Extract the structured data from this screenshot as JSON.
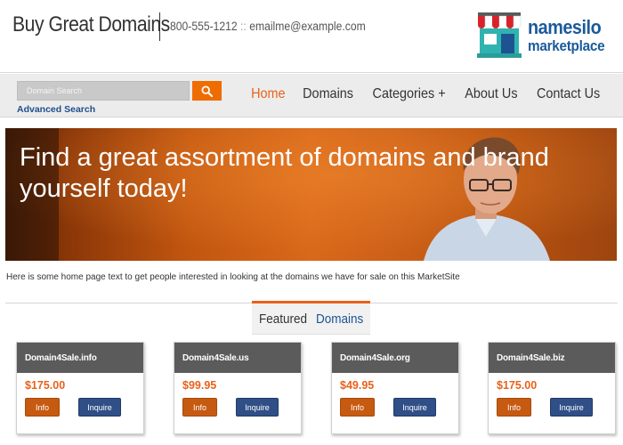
{
  "header": {
    "site_title": "Buy Great Domains",
    "phone": "800-555-1212",
    "separator": "::",
    "email": "emailme@example.com",
    "logo_line1": "namesilo",
    "logo_line2": "marketplace",
    "logo_icon": "storefront-icon"
  },
  "search": {
    "placeholder": "Domain Search",
    "button_icon": "search-icon",
    "advanced_label": "Advanced Search"
  },
  "nav": {
    "items": [
      {
        "label": "Home",
        "active": true
      },
      {
        "label": "Domains",
        "active": false
      },
      {
        "label": "Categories +",
        "active": false
      },
      {
        "label": "About Us",
        "active": false
      },
      {
        "label": "Contact Us",
        "active": false
      }
    ]
  },
  "hero": {
    "headline": "Find a great assortment of domains and brand yourself today!"
  },
  "intro_text": "Here is some home page text to get people interested in looking at the domains we have for sale on this MarketSite",
  "featured": {
    "label_part1": "Featured",
    "label_part2": "Domains",
    "cards": [
      {
        "domain": "Domain4Sale.info",
        "price": "$175.00",
        "info_label": "Info",
        "inquire_label": "Inquire"
      },
      {
        "domain": "Domain4Sale.us",
        "price": "$99.95",
        "info_label": "Info",
        "inquire_label": "Inquire"
      },
      {
        "domain": "Domain4Sale.org",
        "price": "$49.95",
        "info_label": "Info",
        "inquire_label": "Inquire"
      },
      {
        "domain": "Domain4Sale.biz",
        "price": "$175.00",
        "info_label": "Info",
        "inquire_label": "Inquire"
      }
    ]
  },
  "colors": {
    "accent_orange": "#e8611a",
    "brand_blue": "#1e5391",
    "card_header": "#5b5b5b"
  }
}
